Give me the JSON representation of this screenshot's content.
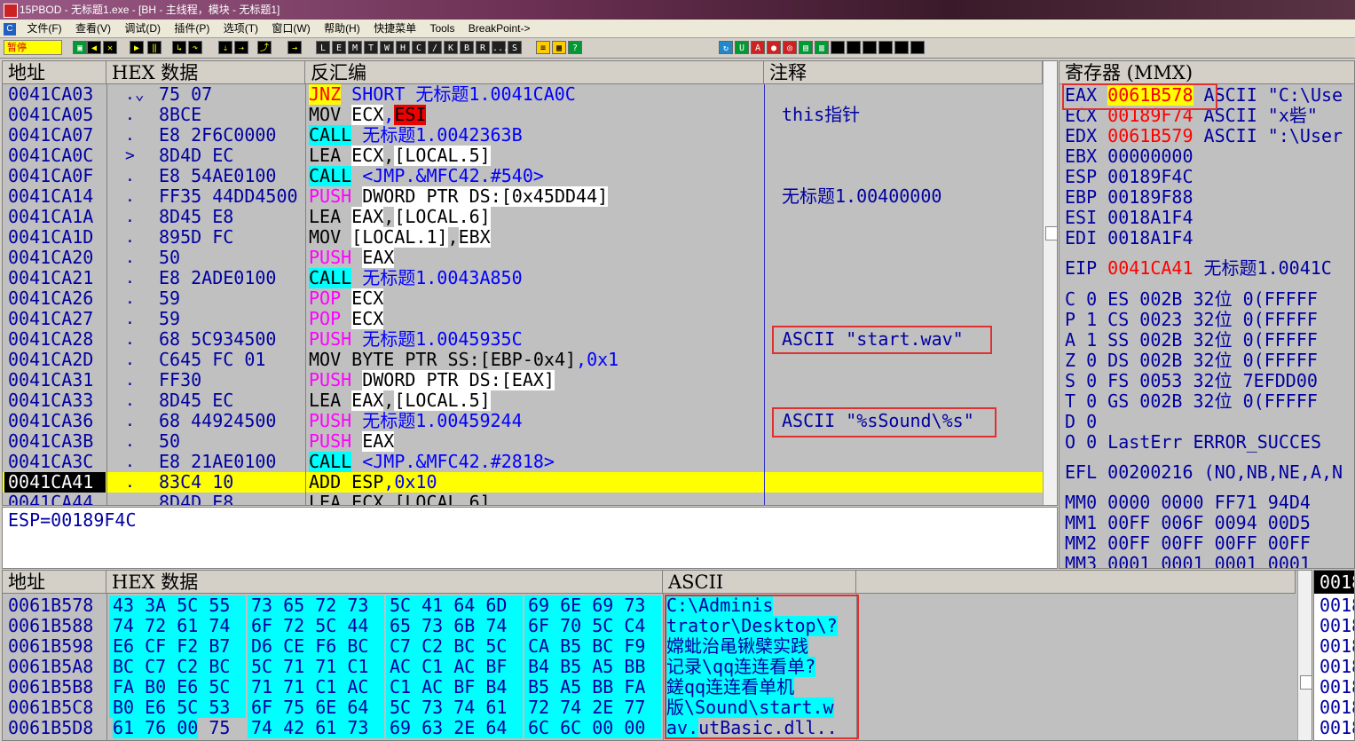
{
  "window": {
    "title": "15PBOD - 无标题1.exe - [BH - 主线程，模块 - 无标题1]"
  },
  "menu": [
    "文件(F)",
    "查看(V)",
    "调试(D)",
    "插件(P)",
    "选项(T)",
    "窗口(W)",
    "帮助(H)",
    "快捷菜单",
    "Tools",
    "BreakPoint->"
  ],
  "toolbar": {
    "pause_label": "暂停",
    "letters": [
      "L",
      "E",
      "M",
      "T",
      "W",
      "H",
      "C",
      "/",
      "K",
      "B",
      "R",
      "...",
      "S"
    ]
  },
  "disasm": {
    "headers": {
      "addr": "地址",
      "hex": "HEX 数据",
      "asm": "反汇编",
      "cmt": "注释"
    },
    "rows": [
      {
        "addr": "0041CA03",
        "mark": ".⌄",
        "hex": "75 07",
        "op": "JNZ",
        "opstyle": "jmp",
        "args": [
          {
            "t": "SHORT 无标题1.0041CA0C",
            "s": "blue"
          }
        ],
        "cmt": ""
      },
      {
        "addr": "0041CA05",
        "mark": ".",
        "hex": "8BCE",
        "op": "MOV",
        "opstyle": "plain",
        "args": [
          {
            "t": "ECX",
            "s": "reg"
          },
          {
            "t": ",",
            "s": "blue"
          },
          {
            "t": "ESI",
            "s": "esi"
          }
        ],
        "cmt": "this指针"
      },
      {
        "addr": "0041CA07",
        "mark": ".",
        "hex": "E8 2F6C0000",
        "op": "CALL",
        "opstyle": "call",
        "args": [
          {
            "t": "无标题1.0042363B",
            "s": "blue"
          }
        ],
        "cmt": ""
      },
      {
        "addr": "0041CA0C",
        "mark": ">",
        "hex": "8D4D EC",
        "op": "LEA",
        "opstyle": "plain",
        "args": [
          {
            "t": "ECX",
            "s": "reg"
          },
          {
            "t": ",",
            "s": "plain"
          },
          {
            "t": "[LOCAL.5]",
            "s": "reg"
          }
        ],
        "cmt": ""
      },
      {
        "addr": "0041CA0F",
        "mark": ".",
        "hex": "E8 54AE0100",
        "op": "CALL",
        "opstyle": "call",
        "args": [
          {
            "t": "<JMP.&MFC42.#540>",
            "s": "blue"
          }
        ],
        "cmt": ""
      },
      {
        "addr": "0041CA14",
        "mark": ".",
        "hex": "FF35 44DD4500",
        "op": "PUSH",
        "opstyle": "push",
        "args": [
          {
            "t": "DWORD PTR DS:[0x45DD44]",
            "s": "reg"
          }
        ],
        "cmt": "无标题1.00400000"
      },
      {
        "addr": "0041CA1A",
        "mark": ".",
        "hex": "8D45 E8",
        "op": "LEA",
        "opstyle": "plain",
        "args": [
          {
            "t": "EAX",
            "s": "reg"
          },
          {
            "t": ",",
            "s": "plain"
          },
          {
            "t": "[LOCAL.6]",
            "s": "reg"
          }
        ],
        "cmt": ""
      },
      {
        "addr": "0041CA1D",
        "mark": ".",
        "hex": "895D FC",
        "op": "MOV",
        "opstyle": "plain",
        "args": [
          {
            "t": "[LOCAL.1]",
            "s": "reg"
          },
          {
            "t": ",",
            "s": "plain"
          },
          {
            "t": "EBX",
            "s": "reg"
          }
        ],
        "cmt": ""
      },
      {
        "addr": "0041CA20",
        "mark": ".",
        "hex": "50",
        "op": "PUSH",
        "opstyle": "push",
        "args": [
          {
            "t": "EAX",
            "s": "reg"
          }
        ],
        "cmt": ""
      },
      {
        "addr": "0041CA21",
        "mark": ".",
        "hex": "E8 2ADE0100",
        "op": "CALL",
        "opstyle": "call",
        "args": [
          {
            "t": "无标题1.0043A850",
            "s": "blue"
          }
        ],
        "cmt": ""
      },
      {
        "addr": "0041CA26",
        "mark": ".",
        "hex": "59",
        "op": "POP",
        "opstyle": "push",
        "args": [
          {
            "t": "ECX",
            "s": "reg"
          }
        ],
        "cmt": ""
      },
      {
        "addr": "0041CA27",
        "mark": ".",
        "hex": "59",
        "op": "POP",
        "opstyle": "push",
        "args": [
          {
            "t": "ECX",
            "s": "reg"
          }
        ],
        "cmt": ""
      },
      {
        "addr": "0041CA28",
        "mark": ".",
        "hex": "68 5C934500",
        "op": "PUSH",
        "opstyle": "push",
        "args": [
          {
            "t": "无标题1.0045935C",
            "s": "blue"
          }
        ],
        "cmt": "ASCII \"start.wav\""
      },
      {
        "addr": "0041CA2D",
        "mark": ".",
        "hex": "C645 FC 01",
        "op": "MOV",
        "opstyle": "plain",
        "args": [
          {
            "t": "BYTE PTR SS:[EBP-0x4]",
            "s": "plain"
          },
          {
            "t": ",0x1",
            "s": "blue"
          }
        ],
        "cmt": ""
      },
      {
        "addr": "0041CA31",
        "mark": ".",
        "hex": "FF30",
        "op": "PUSH",
        "opstyle": "push",
        "args": [
          {
            "t": "DWORD PTR DS:[EAX]",
            "s": "reg"
          }
        ],
        "cmt": ""
      },
      {
        "addr": "0041CA33",
        "mark": ".",
        "hex": "8D45 EC",
        "op": "LEA",
        "opstyle": "plain",
        "args": [
          {
            "t": "EAX",
            "s": "reg"
          },
          {
            "t": ",",
            "s": "plain"
          },
          {
            "t": "[LOCAL.5]",
            "s": "reg"
          }
        ],
        "cmt": ""
      },
      {
        "addr": "0041CA36",
        "mark": ".",
        "hex": "68 44924500",
        "op": "PUSH",
        "opstyle": "push",
        "args": [
          {
            "t": "无标题1.00459244",
            "s": "blue"
          }
        ],
        "cmt": "ASCII \"%sSound\\%s\""
      },
      {
        "addr": "0041CA3B",
        "mark": ".",
        "hex": "50",
        "op": "PUSH",
        "opstyle": "push",
        "args": [
          {
            "t": "EAX",
            "s": "reg"
          }
        ],
        "cmt": ""
      },
      {
        "addr": "0041CA3C",
        "mark": ".",
        "hex": "E8 21AE0100",
        "op": "CALL",
        "opstyle": "call",
        "args": [
          {
            "t": "<JMP.&MFC42.#2818>",
            "s": "blue"
          }
        ],
        "cmt": ""
      },
      {
        "addr": "0041CA41",
        "mark": ".",
        "hex": "83C4 10",
        "op": "ADD",
        "opstyle": "plain",
        "args": [
          {
            "t": "ESP",
            "s": "plain"
          },
          {
            "t": ",0x10",
            "s": "blue"
          }
        ],
        "cmt": "",
        "current": true
      },
      {
        "addr": "0041CA44",
        "mark": ".",
        "hex": "8D4D E8",
        "op": "LEA",
        "opstyle": "plain",
        "args": [
          {
            "t": "ECX",
            "s": "plain"
          },
          {
            "t": ",",
            "s": "plain"
          },
          {
            "t": "[LOCAL.6]",
            "s": "plain"
          }
        ],
        "cmt": ""
      }
    ]
  },
  "info": {
    "text": "ESP=00189F4C"
  },
  "registers": {
    "header": "寄存器 (MMX)",
    "gp": [
      {
        "n": "EAX",
        "v": "0061B578",
        "x": "ASCII \"C:\\Use",
        "hl": true
      },
      {
        "n": "ECX",
        "v": "00189F74",
        "x": "ASCII \"x砦\"",
        "red": true
      },
      {
        "n": "EDX",
        "v": "0061B579",
        "x": "ASCII \":\\User",
        "red": true
      },
      {
        "n": "EBX",
        "v": "00000000",
        "x": ""
      },
      {
        "n": "ESP",
        "v": "00189F4C",
        "x": ""
      },
      {
        "n": "EBP",
        "v": "00189F88",
        "x": ""
      },
      {
        "n": "ESI",
        "v": "0018A1F4",
        "x": ""
      },
      {
        "n": "EDI",
        "v": "0018A1F4",
        "x": ""
      }
    ],
    "eip": {
      "n": "EIP",
      "v": "0041CA41",
      "x": "无标题1.0041C"
    },
    "flags": [
      "C 0  ES 002B 32位 0(FFFFF",
      "P 1  CS 0023 32位 0(FFFFF",
      "A 1  SS 002B 32位 0(FFFFF",
      "Z 0  DS 002B 32位 0(FFFFF",
      "S 0  FS 0053 32位 7EFDD00",
      "T 0  GS 002B 32位 0(FFFFF",
      "D 0",
      "O 0  LastErr ERROR_SUCCES"
    ],
    "efl": "EFL 00200216 (NO,NB,NE,A,N",
    "mmx": [
      "MM0 0000 0000 FF71 94D4",
      "MM1 00FF 006F 0094 00D5",
      "MM2 00FF 00FF 00FF 00FF",
      "MM3 0001 0001 0001 0001"
    ]
  },
  "dump": {
    "headers": {
      "addr": "地址",
      "hex": "HEX 数据",
      "ascii": "ASCII"
    },
    "rows": [
      {
        "addr": "0061B578",
        "hex": [
          "43 3A 5C 55",
          "73 65 72 73",
          "5C 41 64 6D",
          "69 6E 69 73"
        ],
        "ascii": "C:\\Adminis"
      },
      {
        "addr": "0061B588",
        "hex": [
          "74 72 61 74",
          "6F 72 5C 44",
          "65 73 6B 74",
          "6F 70 5C C4"
        ],
        "ascii": "trator\\Desktop\\?"
      },
      {
        "addr": "0061B598",
        "hex": [
          "E6 CF F2 B7",
          "D6 CE F6 BC",
          "C7 C2 BC 5C",
          "CA B5 BC F9"
        ],
        "ascii": "嫦蚍治黾锹檗实践"
      },
      {
        "addr": "0061B5A8",
        "hex": [
          "BC C7 C2 BC",
          "5C 71 71 C1",
          "AC C1 AC BF",
          "B4 B5 A5 BB"
        ],
        "ascii": "记录\\qq连连看单?"
      },
      {
        "addr": "0061B5B8",
        "hex": [
          "FA B0 E6 5C",
          "71 71 C1 AC",
          "C1 AC BF B4",
          "B5 A5 BB FA"
        ],
        "ascii": "  鎈qq连连看单机"
      },
      {
        "addr": "0061B5C8",
        "hex": [
          "B0 E6 5C 53",
          "6F 75 6E 64",
          "5C 73 74 61",
          "72 74 2E 77"
        ],
        "ascii": "版\\Sound\\start.w"
      },
      {
        "addr": "0061B5D8",
        "hex": [
          "61 76 00 75",
          "74 42 61 73",
          "69 63 2E 64",
          "6C 6C 00 00"
        ],
        "ascii": "av.utBasic.dll.."
      }
    ]
  },
  "stack": {
    "header": "0018",
    "rows": [
      "0018",
      "0018",
      "0018",
      "0018",
      "0018",
      "0018",
      "0018"
    ]
  }
}
